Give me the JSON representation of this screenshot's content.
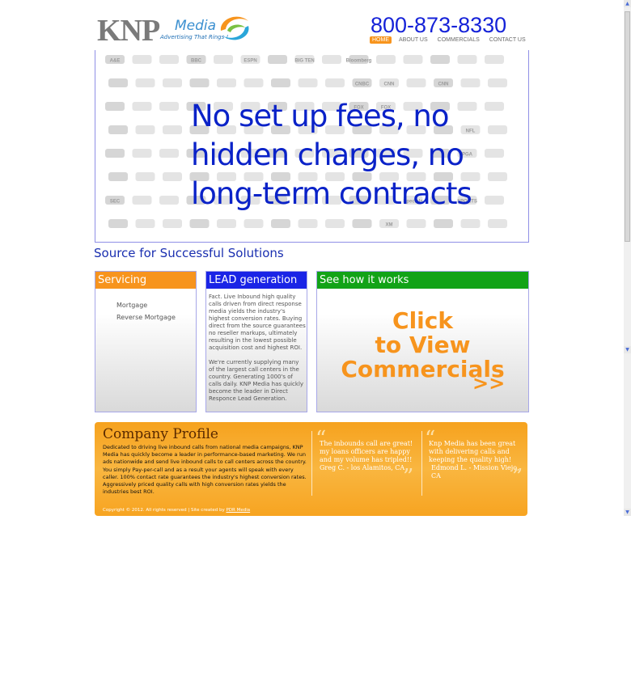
{
  "header": {
    "logo_knp": "KNP",
    "logo_media": "Media",
    "logo_tagline": "Advertising That Rings !",
    "phone": "800-873-8330",
    "nav": [
      {
        "label": "HOME",
        "active": true
      },
      {
        "label": "ABOUT US",
        "active": false
      },
      {
        "label": "COMMERCIALS",
        "active": false
      },
      {
        "label": "CONTACT US",
        "active": false
      }
    ]
  },
  "hero": {
    "line1": "No set up fees, no",
    "line2": "hidden charges, no",
    "line3": "long-term contracts",
    "network_logos": [
      "A&E",
      "",
      "",
      "BBC",
      "",
      "ESPN",
      "",
      "BIG TEN",
      "",
      "Bloomberg",
      "",
      "",
      "",
      "",
      "",
      "",
      "",
      "",
      "",
      "",
      "",
      "",
      "",
      "",
      "CNBC",
      "CNN",
      "",
      "CNN",
      "",
      "",
      "",
      "",
      "",
      "",
      "",
      "",
      "",
      "",
      "",
      "FOX",
      "FOX",
      "",
      "",
      "",
      "",
      "",
      "",
      "",
      "",
      "",
      "",
      "",
      "",
      "",
      "",
      "",
      "",
      "",
      "NFL",
      "",
      "",
      "",
      "",
      "",
      "",
      "",
      "",
      "",
      "",
      "",
      "",
      "",
      "",
      "PGA",
      "",
      "",
      "",
      "",
      "",
      "",
      "",
      "",
      "",
      "",
      "",
      "",
      "",
      "",
      "",
      "",
      "SEC",
      "",
      "",
      "",
      "",
      "",
      "",
      "",
      "",
      "",
      "",
      "Specials",
      "",
      "SPORTS",
      "",
      "",
      "",
      "",
      "",
      "",
      "",
      "",
      "",
      "",
      "",
      "XM",
      "",
      ""
    ]
  },
  "subtitle": "Source for Successful Solutions",
  "servicing": {
    "title": "Servicing",
    "items": [
      "Mortgage",
      "Reverse Mortgage"
    ]
  },
  "lead": {
    "title": "LEAD generation",
    "para1": "Fact. Live Inbound high quality calls driven from direct response media yields the industry's highest conversion rates. Buying direct from the source guarantees no reseller markups, ultimately resulting in the lowest possible acquisition cost and highest ROI.",
    "para2": "We're currently supplying many of the largest call centers in the country. Generating 1000's of calls daily. KNP Media has quickly become the leader in Direct Responce Lead Generation."
  },
  "how": {
    "title": "See how it works",
    "cta_line1": "Click",
    "cta_line2": "to View",
    "cta_line3": "Commercials",
    "cta_arrow": ">>"
  },
  "profile": {
    "title": "Company Profile",
    "text": "Dedicated to driving live inbound calls from national media campaigns, KNP Media has quickly become a leader in performance-based marketing. We run ads nationwide and send live inbound calls to call centers across the country. You simply Pay-per-call and as a result your agents will speak with every caller. 100% contact rate guarantees the industry's highest conversion rates. Aggressively priced quality calls with high conversion rates yields the industries best ROI.",
    "quote1": "The inbounds call are great!  my loans officers are happy and my volume has tripled!!",
    "quote1_author": "Greg C. - los Alamitos, CA",
    "quote2": "Knp Media has been great with delivering calls and keeping the quality high!",
    "quote2_author": "Edmond L. - Mission Viejo, CA",
    "open_quote": "“",
    "close_quote": "”",
    "copyright": "Copyright © 2012. All rights reserved  |  Site created by ",
    "copyright_link": "PDR Media"
  },
  "colors": {
    "accent_orange": "#f7941d",
    "nav_blue": "#1522d8",
    "lead_blue": "#1a24e6",
    "green": "#12a317"
  }
}
